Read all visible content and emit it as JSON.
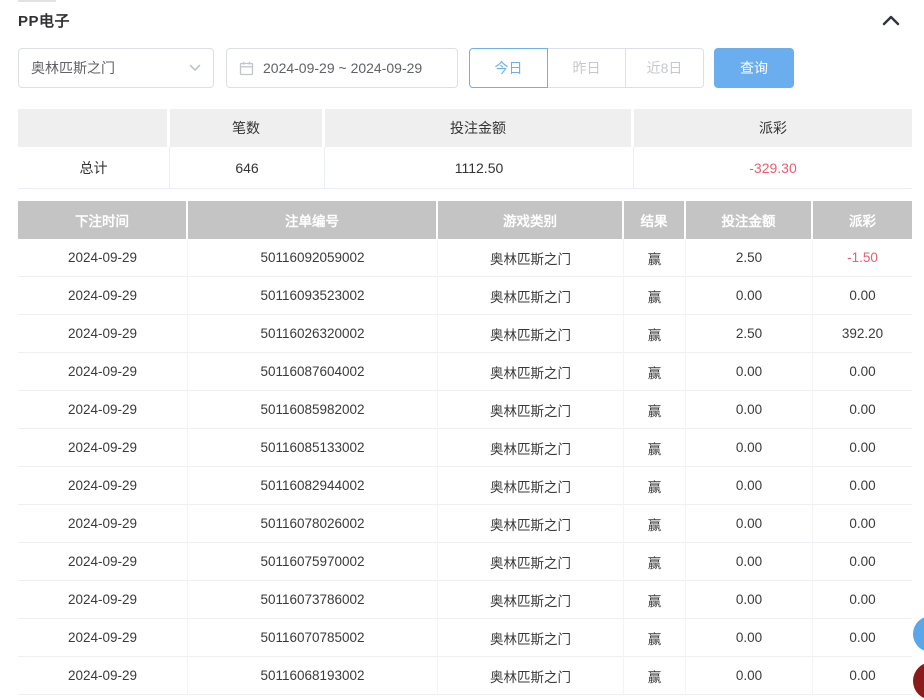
{
  "page": {
    "title": "PP电子"
  },
  "icons": {
    "collapse": "chevron-up-icon",
    "select_arrow": "chevron-down-icon",
    "date": "calendar-icon"
  },
  "filters": {
    "game_select": {
      "value": "奥林匹斯之门"
    },
    "date_range": {
      "value": "2024-09-29 ~ 2024-09-29"
    },
    "quick_buttons": [
      {
        "label": "今日",
        "active": true
      },
      {
        "label": "昨日",
        "active": false
      },
      {
        "label": "近8日",
        "active": false
      }
    ],
    "search_label": "查询"
  },
  "summary": {
    "headers": [
      "",
      "笔数",
      "投注金额",
      "派彩"
    ],
    "total": {
      "label": "总计",
      "count": "646",
      "bet_amount": "1112.50",
      "payout": "-329.30"
    }
  },
  "table": {
    "headers": [
      "下注时间",
      "注单编号",
      "游戏类别",
      "结果",
      "投注金额",
      "派彩"
    ],
    "rows": [
      {
        "time": "2024-09-29",
        "bet_no": "50116092059002",
        "game": "奥林匹斯之门",
        "result": "赢",
        "amount": "2.50",
        "payout": "-1.50"
      },
      {
        "time": "2024-09-29",
        "bet_no": "50116093523002",
        "game": "奥林匹斯之门",
        "result": "赢",
        "amount": "0.00",
        "payout": "0.00"
      },
      {
        "time": "2024-09-29",
        "bet_no": "50116026320002",
        "game": "奥林匹斯之门",
        "result": "赢",
        "amount": "2.50",
        "payout": "392.20"
      },
      {
        "time": "2024-09-29",
        "bet_no": "50116087604002",
        "game": "奥林匹斯之门",
        "result": "赢",
        "amount": "0.00",
        "payout": "0.00"
      },
      {
        "time": "2024-09-29",
        "bet_no": "50116085982002",
        "game": "奥林匹斯之门",
        "result": "赢",
        "amount": "0.00",
        "payout": "0.00"
      },
      {
        "time": "2024-09-29",
        "bet_no": "50116085133002",
        "game": "奥林匹斯之门",
        "result": "赢",
        "amount": "0.00",
        "payout": "0.00"
      },
      {
        "time": "2024-09-29",
        "bet_no": "50116082944002",
        "game": "奥林匹斯之门",
        "result": "赢",
        "amount": "0.00",
        "payout": "0.00"
      },
      {
        "time": "2024-09-29",
        "bet_no": "50116078026002",
        "game": "奥林匹斯之门",
        "result": "赢",
        "amount": "0.00",
        "payout": "0.00"
      },
      {
        "time": "2024-09-29",
        "bet_no": "50116075970002",
        "game": "奥林匹斯之门",
        "result": "赢",
        "amount": "0.00",
        "payout": "0.00"
      },
      {
        "time": "2024-09-29",
        "bet_no": "50116073786002",
        "game": "奥林匹斯之门",
        "result": "赢",
        "amount": "0.00",
        "payout": "0.00"
      },
      {
        "time": "2024-09-29",
        "bet_no": "50116070785002",
        "game": "奥林匹斯之门",
        "result": "赢",
        "amount": "0.00",
        "payout": "0.00"
      },
      {
        "time": "2024-09-29",
        "bet_no": "50116068193002",
        "game": "奥林匹斯之门",
        "result": "赢",
        "amount": "0.00",
        "payout": "0.00"
      }
    ]
  },
  "colors": {
    "accent_blue": "#6aaef0",
    "active_tab_blue": "#6cb2e8",
    "danger_red": "#ee5d6d",
    "table_header_gray": "#c4c4c4",
    "summary_header_gray": "#efefef",
    "float_blue": "#59a7e8",
    "float_red": "#8b1a1a"
  }
}
